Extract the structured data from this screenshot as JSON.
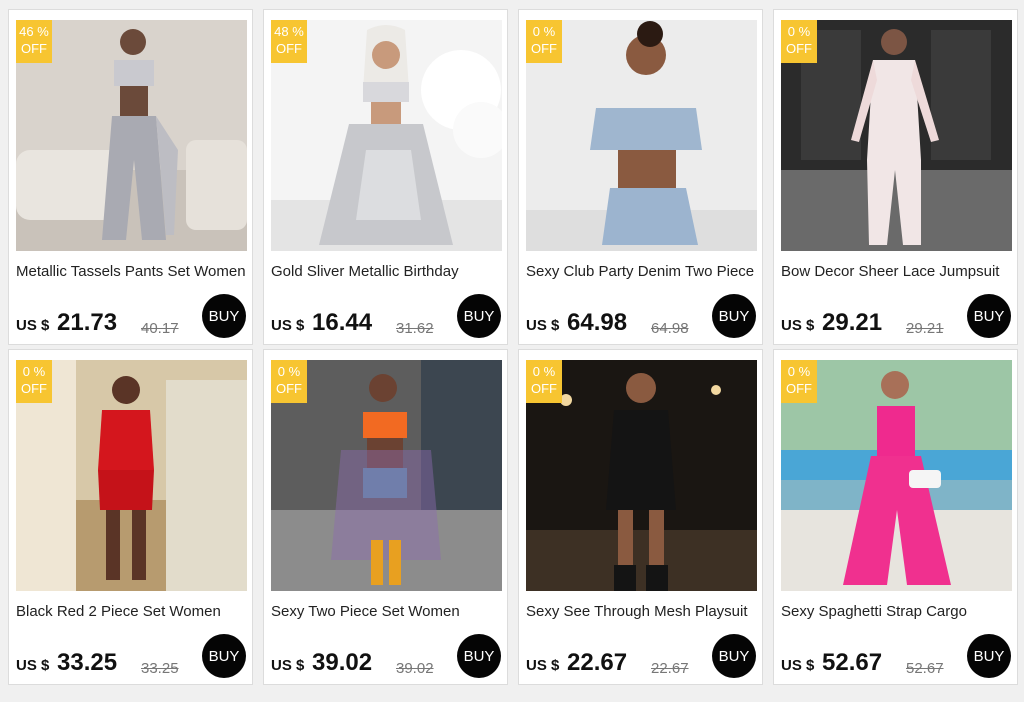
{
  "products": [
    {
      "discount": "46 %",
      "off": "OFF",
      "title": "Metallic Tassels Pants Set Women",
      "currency": "US $",
      "price": "21.73",
      "original": "40.17",
      "buy": "BUY",
      "palette": {
        "bg": "#d9d3cc",
        "bg2": "#c9c2ba",
        "top": "#c9c9cf",
        "bottom": "#a9aab2",
        "skin": "#6b4a3a"
      }
    },
    {
      "discount": "48 %",
      "off": "OFF",
      "title": "Gold Sliver Metallic Birthday",
      "currency": "US $",
      "price": "16.44",
      "original": "31.62",
      "buy": "BUY",
      "palette": {
        "bg": "#f4f4f4",
        "bg2": "#e4e4e4",
        "top": "#d8d8dc",
        "bottom": "#c7c8cc",
        "skin": "#c89a7c"
      }
    },
    {
      "discount": "0 %",
      "off": "OFF",
      "title": "Sexy Club Party Denim Two Piece",
      "currency": "US $",
      "price": "64.98",
      "original": "64.98",
      "buy": "BUY",
      "palette": {
        "bg": "#ececec",
        "bg2": "#dedede",
        "top": "#9fb6cf",
        "bottom": "#9cb4cf",
        "skin": "#8a5a40"
      }
    },
    {
      "discount": "0 %",
      "off": "OFF",
      "title": "Bow Decor Sheer Lace Jumpsuit",
      "currency": "US $",
      "price": "29.21",
      "original": "29.21",
      "buy": "BUY",
      "palette": {
        "bg": "#2b2b2b",
        "bg2": "#6a6a6a",
        "top": "#f1e6e6",
        "bottom": "#eedada",
        "skin": "#7c5544"
      }
    },
    {
      "discount": "0 %",
      "off": "OFF",
      "title": "Black Red 2 Piece Set Women",
      "currency": "US $",
      "price": "33.25",
      "original": "33.25",
      "buy": "BUY",
      "palette": {
        "bg": "#d7c8a8",
        "bg2": "#b79b6f",
        "top": "#d4161d",
        "bottom": "#c51219",
        "skin": "#5a3426"
      }
    },
    {
      "discount": "0 %",
      "off": "OFF",
      "title": "Sexy Two Piece Set Women",
      "currency": "US $",
      "price": "39.02",
      "original": "39.02",
      "buy": "BUY",
      "palette": {
        "bg": "#5d5d5d",
        "bg2": "#8c8c8c",
        "top": "#f26a22",
        "bottom": "#5a8fa8",
        "skin": "#6b4232"
      }
    },
    {
      "discount": "0 %",
      "off": "OFF",
      "title": "Sexy See Through Mesh Playsuit",
      "currency": "US $",
      "price": "22.67",
      "original": "22.67",
      "buy": "BUY",
      "palette": {
        "bg": "#1a1612",
        "bg2": "#3d3024",
        "top": "#141414",
        "bottom": "#1c1c1c",
        "skin": "#8a5a40"
      }
    },
    {
      "discount": "0 %",
      "off": "OFF",
      "title": "Sexy Spaghetti Strap Cargo",
      "currency": "US $",
      "price": "52.67",
      "original": "52.67",
      "buy": "BUY",
      "palette": {
        "bg": "#7fb4c8",
        "bg2": "#e7e4de",
        "top": "#ef2a8e",
        "bottom": "#f0308f",
        "skin": "#a87058"
      }
    }
  ],
  "badge_color": "#f7c531",
  "buy_color": "#050505"
}
